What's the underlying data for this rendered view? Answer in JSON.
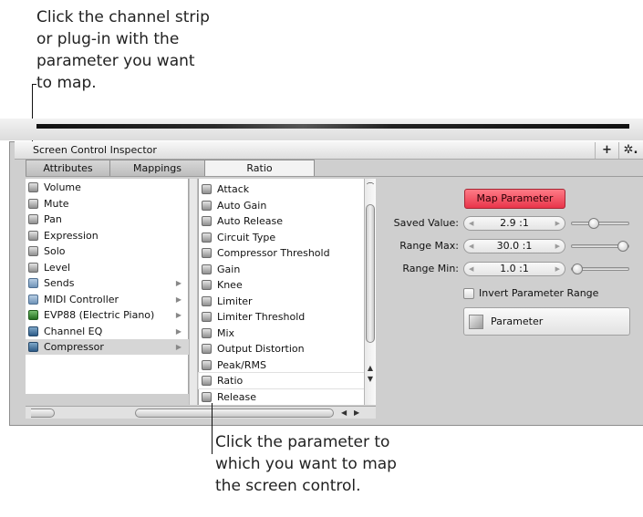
{
  "callouts": {
    "top": "Click the channel strip\nor plug-in with the\nparameter you want\nto map.",
    "bottom": "Click the parameter to\nwhich you want to map\nthe screen control."
  },
  "window": {
    "title": "Screen Control Inspector",
    "plus_label": "+",
    "gear_label": "✲."
  },
  "tabs": [
    "Attributes",
    "Mappings",
    "Ratio"
  ],
  "left_list": [
    {
      "label": "Volume",
      "icon": "parameter-icon"
    },
    {
      "label": "Mute",
      "icon": "parameter-icon"
    },
    {
      "label": "Pan",
      "icon": "parameter-icon"
    },
    {
      "label": "Expression",
      "icon": "parameter-icon"
    },
    {
      "label": "Solo",
      "icon": "parameter-icon"
    },
    {
      "label": "Level",
      "icon": "parameter-icon"
    },
    {
      "label": "Sends",
      "icon": "folder-icon",
      "submenu": "▶"
    },
    {
      "label": "MIDI Controller",
      "icon": "folder-icon",
      "submenu": "▶"
    },
    {
      "label": "EVP88  (Electric Piano)",
      "icon": "instrument-icon",
      "submenu": "▶"
    },
    {
      "label": "Channel EQ",
      "icon": "plugin-icon",
      "submenu": "▶"
    },
    {
      "label": "Compressor",
      "icon": "plugin-icon",
      "submenu": "▶"
    }
  ],
  "right_list": [
    "Attack",
    "Auto Gain",
    "Auto Release",
    "Circuit Type",
    "Compressor Threshold",
    "Gain",
    "Knee",
    "Limiter",
    "Limiter Threshold",
    "Mix",
    "Output Distortion",
    "Peak/RMS",
    "Ratio",
    "Release"
  ],
  "selected_source": "Compressor",
  "selected_parameter": "Ratio",
  "map_button": "Map Parameter",
  "fields": {
    "saved_value": {
      "label": "Saved Value:",
      "value": "2.9 :1",
      "slider_fraction": 0.35
    },
    "range_max": {
      "label": "Range Max:",
      "value": "30.0 :1",
      "slider_fraction": 1.0
    },
    "range_min": {
      "label": "Range Min:",
      "value": "1.0 :1",
      "slider_fraction": 0.0
    }
  },
  "invert_label": "Invert Parameter Range",
  "invert_checked": false,
  "parameter_label": "Parameter",
  "colors": {
    "map_button": "#f04a5b",
    "selection": "#d6d6d6"
  }
}
